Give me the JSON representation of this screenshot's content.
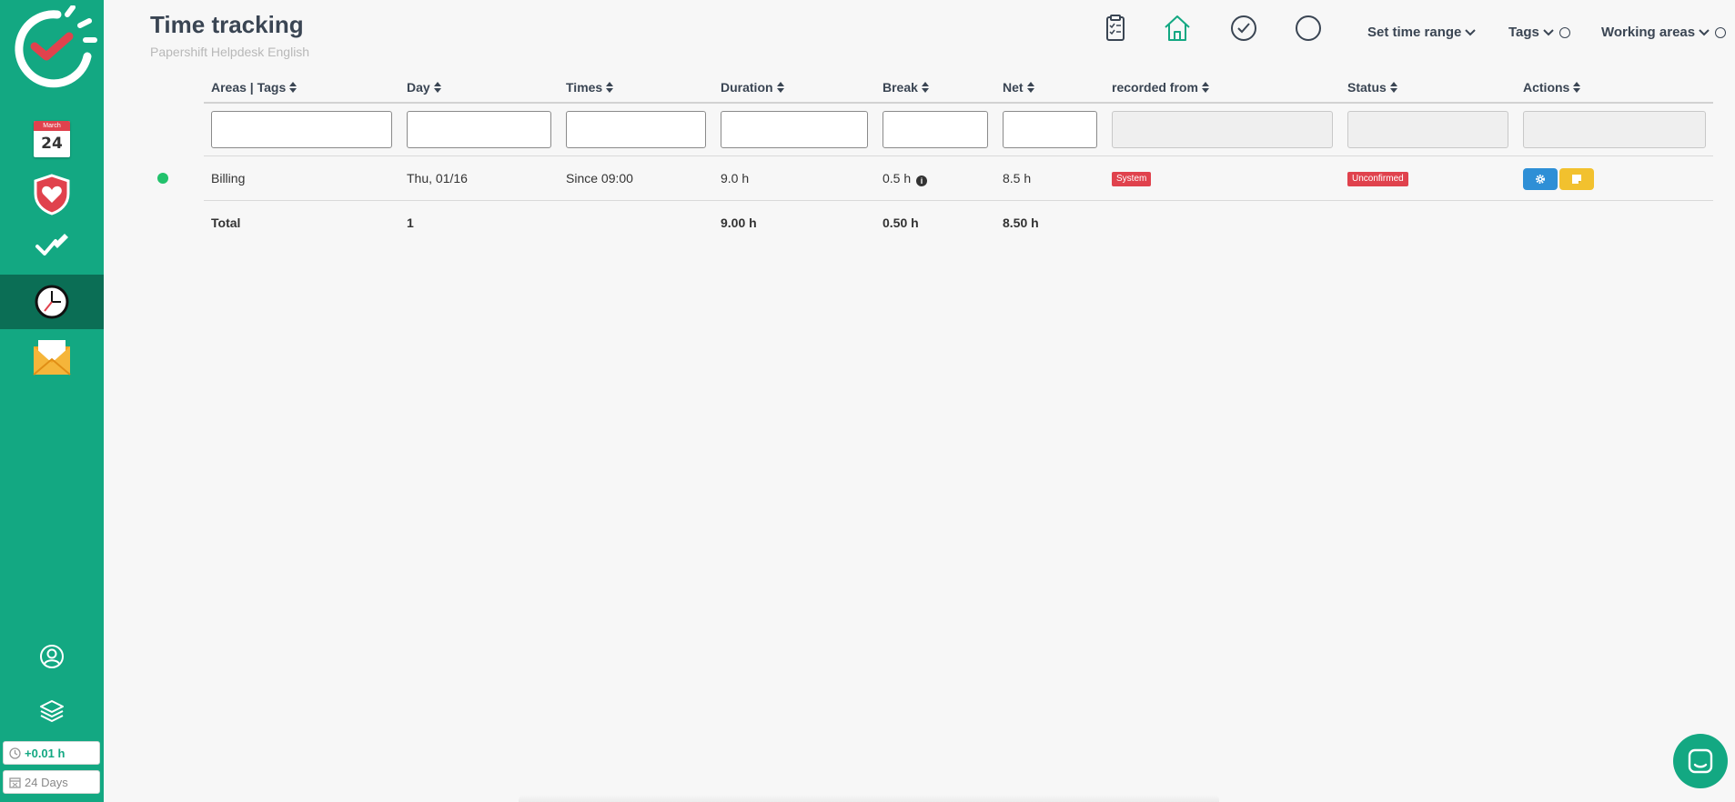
{
  "colors": {
    "brand": "#13a882",
    "sidebar_active": "#0b6e55",
    "danger": "#e0424d",
    "status_dot": "#22c26c",
    "action_blue": "#2e8fd6",
    "action_yellow": "#f2c12e"
  },
  "sidebar": {
    "calendar": {
      "month": "March",
      "day": "24"
    },
    "items": [
      {
        "icon": "calendar-icon"
      },
      {
        "icon": "shield-heart-icon"
      },
      {
        "icon": "check-pen-icon"
      },
      {
        "icon": "clock-icon",
        "active": true
      },
      {
        "icon": "mail-icon"
      }
    ],
    "bottom": [
      {
        "icon": "user-icon"
      },
      {
        "icon": "layers-icon"
      }
    ],
    "overtime": "+0.01 h",
    "days": "24 Days"
  },
  "header": {
    "title": "Time tracking",
    "subtitle": "Papershift Helpdesk English",
    "icons": [
      "clipboard-icon",
      "home-icon",
      "check-circle-icon",
      "circle-icon"
    ],
    "menus": {
      "time_range": "Set time range",
      "tags": "Tags",
      "working_areas": "Working areas"
    }
  },
  "table": {
    "columns": {
      "areas": "Areas | Tags",
      "day": "Day",
      "times": "Times",
      "duration": "Duration",
      "break": "Break",
      "net": "Net",
      "recorded_from": "recorded from",
      "status": "Status",
      "actions": "Actions"
    },
    "rows": [
      {
        "area": "Billing",
        "day": "Thu, 01/16",
        "times": "Since 09:00",
        "duration": "9.0 h",
        "break": "0.5 h",
        "net": "8.5 h",
        "recorded_from": "System",
        "status": "Unconfirmed"
      }
    ],
    "total": {
      "label": "Total",
      "count": "1",
      "duration": "9.00 h",
      "break": "0.50 h",
      "net": "8.50 h"
    }
  }
}
